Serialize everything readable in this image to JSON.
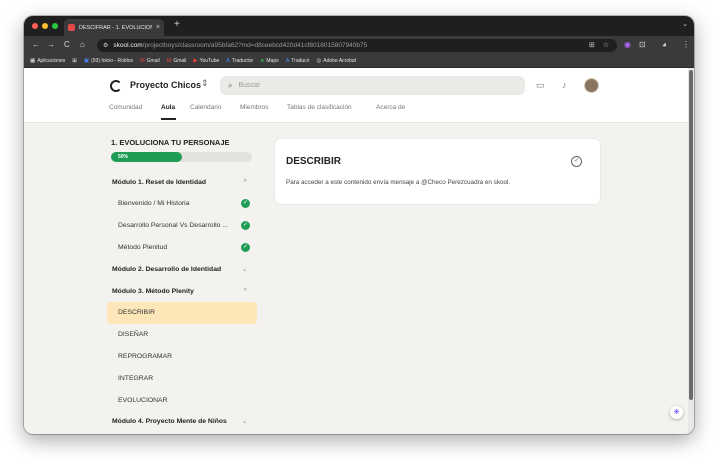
{
  "browser": {
    "tab_title": "DESCIFRAR - 1. EVOLUCIONA",
    "tab_close": "×",
    "new_tab": "+",
    "tabs_menu": "⌄",
    "nav": {
      "back": "←",
      "forward": "→",
      "reload": "C",
      "home": "⌂"
    },
    "url_host": "skool.com",
    "url_path": "/projectboys/classroom/a95bfa62?md=d8ceebcd420d41cf8018015807940b75",
    "omni_icons": {
      "translate": "⊞",
      "bookmark": "☆"
    },
    "extensions": {
      "ext1": "◉",
      "ext2": "⊡",
      "profile": "◕",
      "menu": "⋮"
    },
    "bookmarks": [
      {
        "icon": "▦",
        "label": "Aplicaciones"
      },
      {
        "icon": "⊞",
        "label": ""
      },
      {
        "icon": "▣",
        "label": "(93) Inicio - Roblox"
      },
      {
        "icon": "M",
        "label": "Gmail"
      },
      {
        "icon": "M",
        "label": "Gmail"
      },
      {
        "icon": "▶",
        "label": "YouTube"
      },
      {
        "icon": "A",
        "label": "Traductor"
      },
      {
        "icon": "◈",
        "label": "Maps"
      },
      {
        "icon": "A",
        "label": "Traducir"
      },
      {
        "icon": "◎",
        "label": "Adobe Acrobat"
      }
    ]
  },
  "header": {
    "group_name": "Proyecto Chicos",
    "switch_icon": "⇕",
    "search_placeholder": "Buscar",
    "search_icon": "🔍",
    "chat_icon": "💬",
    "bell_icon": "🔔",
    "tabs": [
      "Comunidad",
      "Aula",
      "Calendario",
      "Miembros",
      "Tablas de clasificación",
      "Acerca de"
    ],
    "active_tab": "Aula"
  },
  "sidebar": {
    "course_title": "1. EVOLUCIONA TU PERSONAJE",
    "progress_label": "50%",
    "progress_value": 0.5,
    "rows": [
      {
        "type": "module",
        "label": "Módulo 1. Reset de Identidad",
        "chevron": "^"
      },
      {
        "type": "lesson",
        "label": "Bienvenido / Mi Historia",
        "done": "✓"
      },
      {
        "type": "lesson",
        "label": "Desarrollo Personal Vs Desarrollo ...",
        "done": "✓"
      },
      {
        "type": "lesson",
        "label": "Método Plenitud",
        "done": "✓"
      },
      {
        "type": "module",
        "label": "Módulo 2. Desarrollo de Identidad",
        "chevron": "⌄"
      },
      {
        "type": "module",
        "label": "Módulo 3. Método Plenity",
        "chevron": "^"
      },
      {
        "type": "lesson",
        "label": "DESCRIBIR",
        "active": true
      },
      {
        "type": "lesson",
        "label": "DISEÑAR"
      },
      {
        "type": "lesson",
        "label": "REPROGRAMAR"
      },
      {
        "type": "lesson",
        "label": "INTEGRAR"
      },
      {
        "type": "lesson",
        "label": "EVOLUCIONAR"
      },
      {
        "type": "module",
        "label": "Módulo 4. Proyecto Mente de Niños",
        "chevron": "⌄"
      }
    ]
  },
  "content": {
    "title": "DESCRIBIR",
    "check_icon": "✓",
    "message": "Para acceder a este contenido envía mensaje a @Checo Perezcuadra en skool."
  },
  "fab_icon": "❋",
  "colors": {
    "accent_green": "#1f9d55",
    "active_row": "#fde7b8"
  }
}
